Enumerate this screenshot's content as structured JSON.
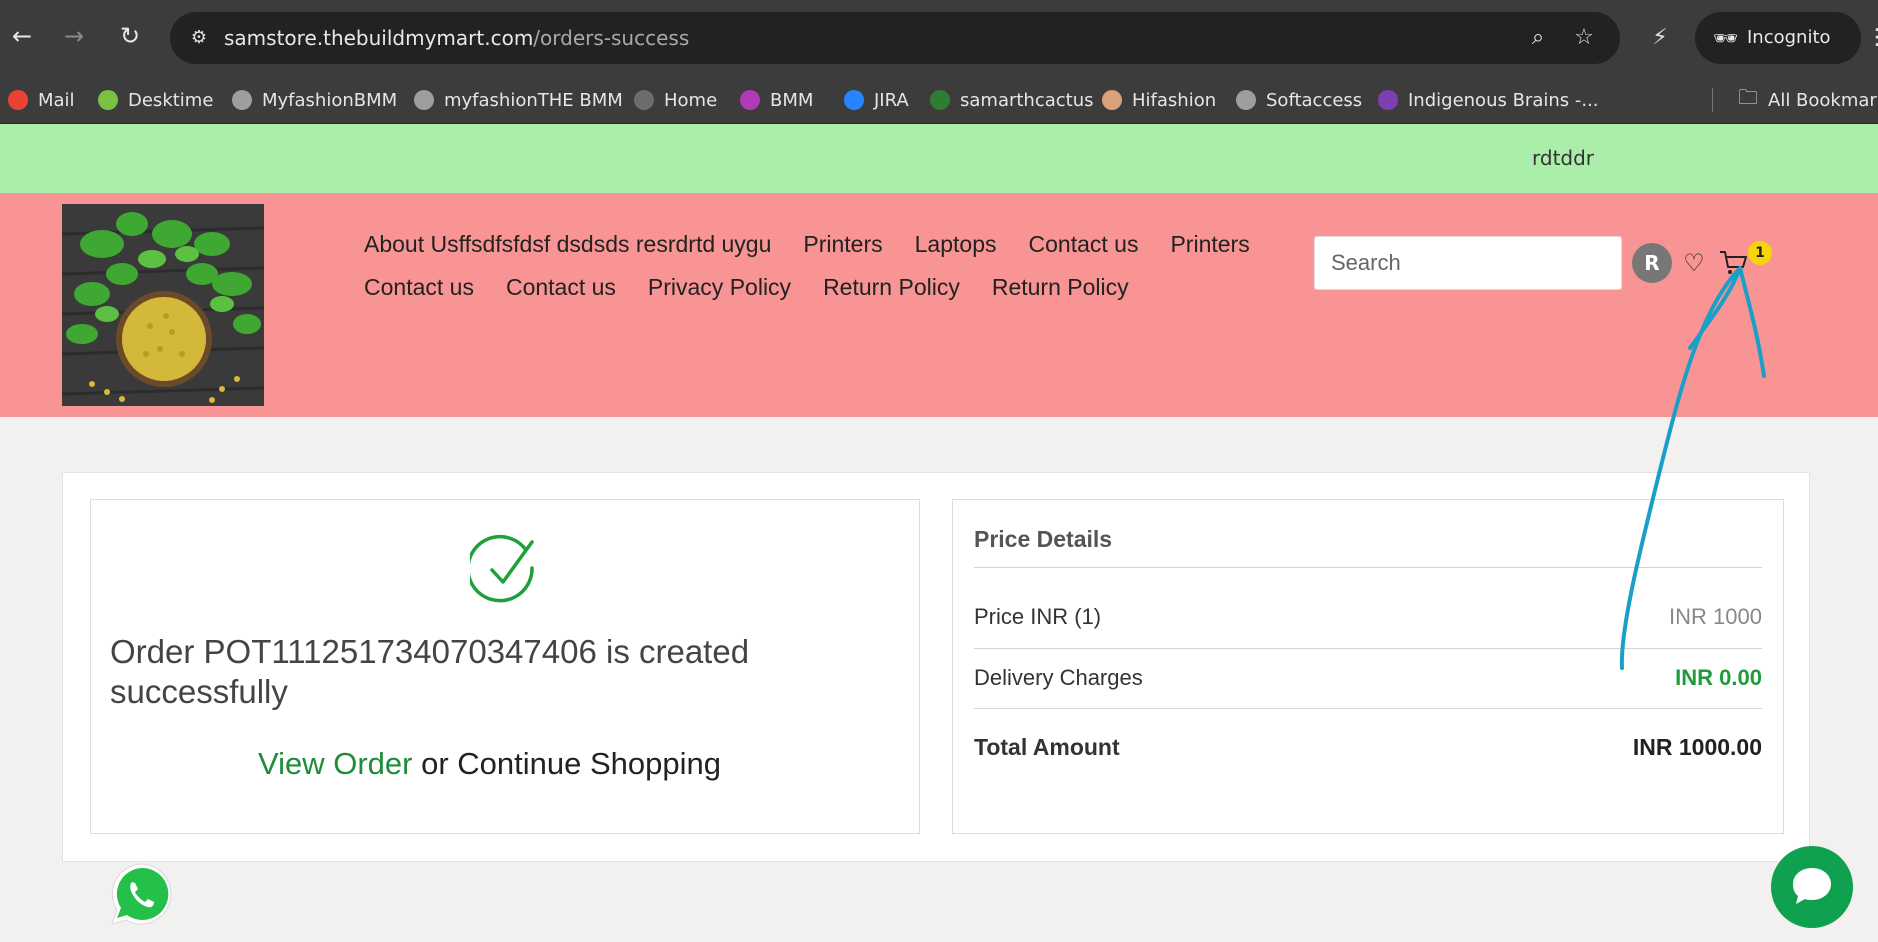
{
  "browser": {
    "url_host": "samstore.thebuildmymart.com",
    "url_path": "/orders-success",
    "incognito_label": "Incognito",
    "bookmarks": [
      {
        "label": "Mail",
        "color": "#ea4335"
      },
      {
        "label": "Desktime",
        "color": "#7ac143"
      },
      {
        "label": "MyfashionBMM",
        "color": "#9e9e9e"
      },
      {
        "label": "myfashionTHE BMM",
        "color": "#9e9e9e"
      },
      {
        "label": "Home",
        "color": "#6d6d6d"
      },
      {
        "label": "BMM",
        "color": "#b03ab8"
      },
      {
        "label": "JIRA",
        "color": "#2684ff"
      },
      {
        "label": "samarthcactus",
        "color": "#2e7d32"
      },
      {
        "label": "Hifashion",
        "color": "#d9a27b"
      },
      {
        "label": "Softaccess",
        "color": "#9e9e9e"
      },
      {
        "label": "Indigenous Brains -...",
        "color": "#7e3fb5"
      }
    ],
    "all_bookmarks_label": "All Bookmarks"
  },
  "site": {
    "announcement": "rdtddr",
    "nav_row1": [
      "About Usffsdfsfdsf dsdsds resrdrtd uygu",
      "Printers",
      "Laptops",
      "Contact us",
      "Printers"
    ],
    "nav_row2": [
      "Contact us",
      "Contact us",
      "Privacy Policy",
      "Return Policy",
      "Return Policy"
    ],
    "search_placeholder": "Search",
    "avatar_initial": "R",
    "cart_count": "1"
  },
  "order": {
    "message": "Order POT111251734070347406 is created successfully",
    "view_order": "View Order",
    "or_text": " or ",
    "continue_shopping": "Continue Shopping"
  },
  "price_details": {
    "title": "Price Details",
    "price_label": "Price INR (1)",
    "price_value": "INR 1000",
    "delivery_label": "Delivery Charges",
    "delivery_value": "INR 0.00",
    "total_label": "Total Amount",
    "total_value": "INR 1000.00"
  },
  "colors": {
    "announcement_bg": "#aaeeaa",
    "header_bg": "#f89494",
    "accent_green": "#1f8c3a",
    "annotation_blue": "#1aa0c8"
  }
}
